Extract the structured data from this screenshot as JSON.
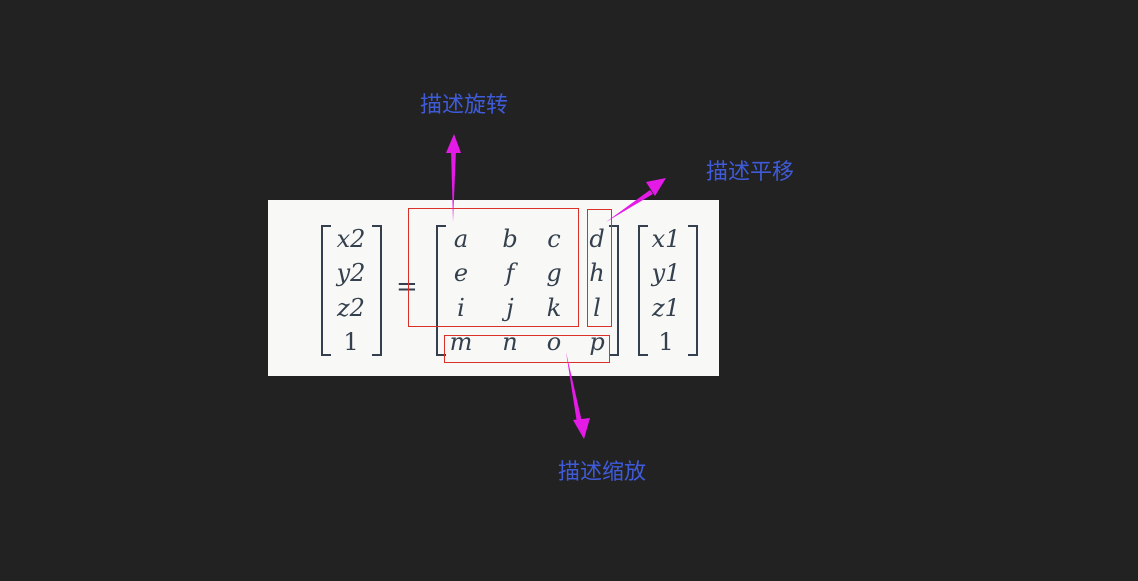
{
  "labels": {
    "rotation": "描述旋转",
    "translation": "描述平移",
    "scale": "描述缩放"
  },
  "equation": {
    "lhs": [
      "x2",
      "y2",
      "z2",
      "1"
    ],
    "equals": "=",
    "matrix": [
      [
        "a",
        "b",
        "c",
        "d"
      ],
      [
        "e",
        "f",
        "g",
        "h"
      ],
      [
        "i",
        "j",
        "k",
        "l"
      ],
      [
        "m",
        "n",
        "o",
        "p"
      ]
    ],
    "rhs": [
      "x1",
      "y1",
      "z1",
      "1"
    ]
  },
  "colors": {
    "background": "#222222",
    "panel": "#f8f8f6",
    "label_text": "#3f5bd9",
    "box_outline": "#d9302a",
    "arrow": "#e41be6",
    "math_text": "#34404e"
  }
}
